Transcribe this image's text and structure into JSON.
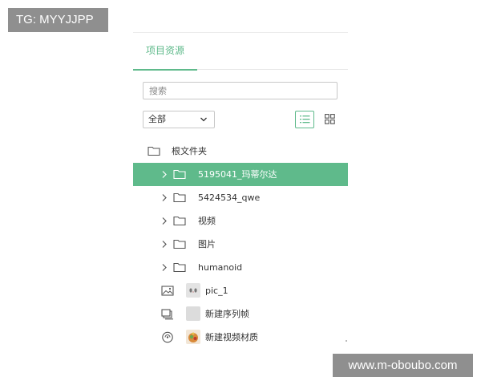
{
  "watermarks": {
    "top_left": "TG: MYYJJPP",
    "bottom_right": "www.m-oboubo.com"
  },
  "panel": {
    "tab_label": "项目资源",
    "search_placeholder": "搜索",
    "filter_selected": "全部",
    "accent_color": "#5fba8b"
  },
  "tree": {
    "root_label": "根文件夹",
    "folders": [
      {
        "label": "5195041_玛蒂尔达",
        "selected": true,
        "icon": "folder-icon"
      },
      {
        "label": "5424534_qwe",
        "selected": false,
        "icon": "folder-icon"
      },
      {
        "label": "视频",
        "selected": false,
        "icon": "folder-icon"
      },
      {
        "label": "图片",
        "selected": false,
        "icon": "folder-icon"
      },
      {
        "label": "humanoid",
        "selected": false,
        "icon": "folder-icon"
      }
    ],
    "items": [
      {
        "label": "pic_1",
        "type_icon": "image-icon",
        "thumb": "pic-thumbnail"
      },
      {
        "label": "新建序列帧",
        "type_icon": "sequence-frames-icon",
        "thumb": "blank-thumbnail"
      },
      {
        "label": "新建视频材质",
        "type_icon": "video-material-icon",
        "thumb": "material-thumbnail"
      }
    ]
  }
}
